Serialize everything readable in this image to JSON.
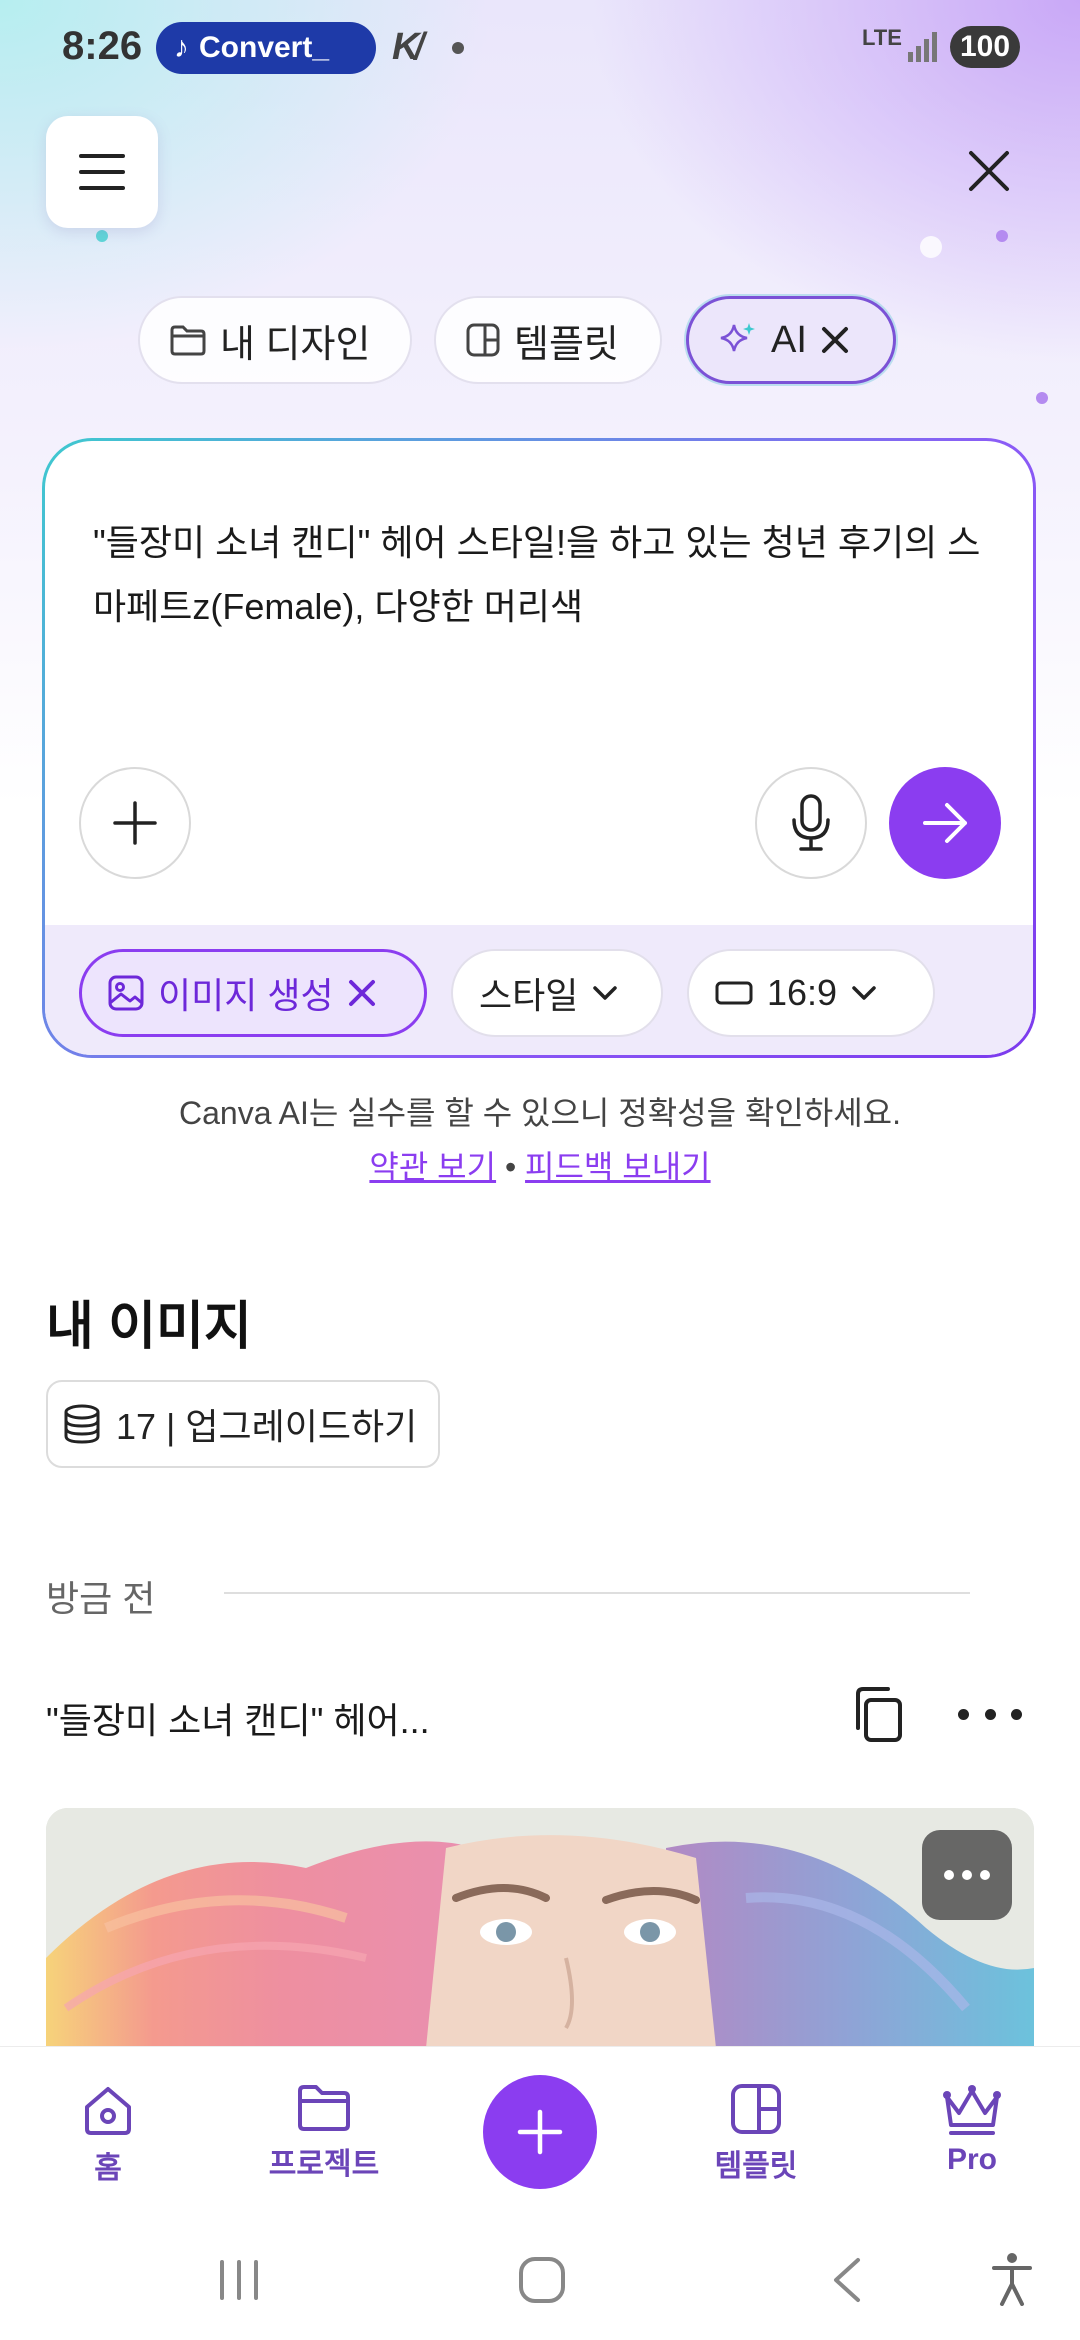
{
  "status_bar": {
    "time": "8:26",
    "notification_label": "Convert_",
    "network": "LTE",
    "battery": "100"
  },
  "filter_chips": [
    {
      "label": "내 디자인",
      "icon": "folder-icon"
    },
    {
      "label": "템플릿",
      "icon": "template-icon"
    },
    {
      "label": "AI",
      "icon": "sparkle-icon",
      "selected": true
    }
  ],
  "prompt": {
    "text": "\"들장미 소녀 캔디\" 헤어 스타일!을 하고 있는 청년 후기의 스마페트z(Female), 다양한 머리색"
  },
  "options": {
    "mode_label": "이미지 생성",
    "style_label": "스타일",
    "ratio_label": "16:9"
  },
  "disclaimer": {
    "text": "Canva AI는 실수를 할 수 있으니 정확성을 확인하세요.",
    "terms_link": "약관 보기",
    "separator": "•",
    "feedback_link": "피드백 보내기"
  },
  "my_images": {
    "title": "내 이미지",
    "credits_label": "17 | 업그레이드하기",
    "time_group": "방금 전",
    "item_title": "\"들장미 소녀 캔디\" 헤어..."
  },
  "bottom_nav": [
    {
      "label": "홈",
      "icon": "home-icon"
    },
    {
      "label": "프로젝트",
      "icon": "folder-icon"
    },
    {
      "label": "템플릿",
      "icon": "template-icon"
    },
    {
      "label": "Pro",
      "icon": "crown-icon"
    }
  ],
  "colors": {
    "accent": "#8b3df0",
    "nav_text": "#6b45b8"
  }
}
